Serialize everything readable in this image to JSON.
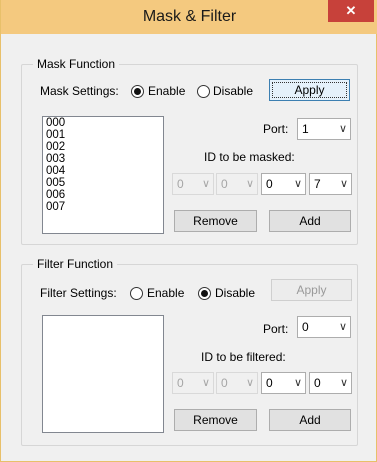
{
  "window": {
    "title": "Mask & Filter",
    "close_glyph": "✕"
  },
  "mask": {
    "group_label": "Mask Function",
    "settings_label": "Mask Settings:",
    "enable_label": "Enable",
    "disable_label": "Disable",
    "mode": "enable",
    "apply_label": "Apply",
    "list_items": [
      "000",
      "001",
      "002",
      "003",
      "004",
      "005",
      "006",
      "007"
    ],
    "port_label": "Port:",
    "port_value": "1",
    "id_label": "ID to be masked:",
    "id_values": [
      "0",
      "0",
      "0",
      "7"
    ],
    "remove_label": "Remove",
    "add_label": "Add"
  },
  "filter": {
    "group_label": "Filter Function",
    "settings_label": "Filter Settings:",
    "enable_label": "Enable",
    "disable_label": "Disable",
    "mode": "disable",
    "apply_label": "Apply",
    "list_items": [],
    "port_label": "Port:",
    "port_value": "0",
    "id_label": "ID to be filtered:",
    "id_values": [
      "0",
      "0",
      "0",
      "0"
    ],
    "remove_label": "Remove",
    "add_label": "Add"
  },
  "icons": {
    "dropdown": "chevron-down-icon",
    "close": "close-icon"
  },
  "colors": {
    "titlebar": "#f4c97f",
    "close": "#c7413a",
    "face": "#f0f0f0"
  }
}
